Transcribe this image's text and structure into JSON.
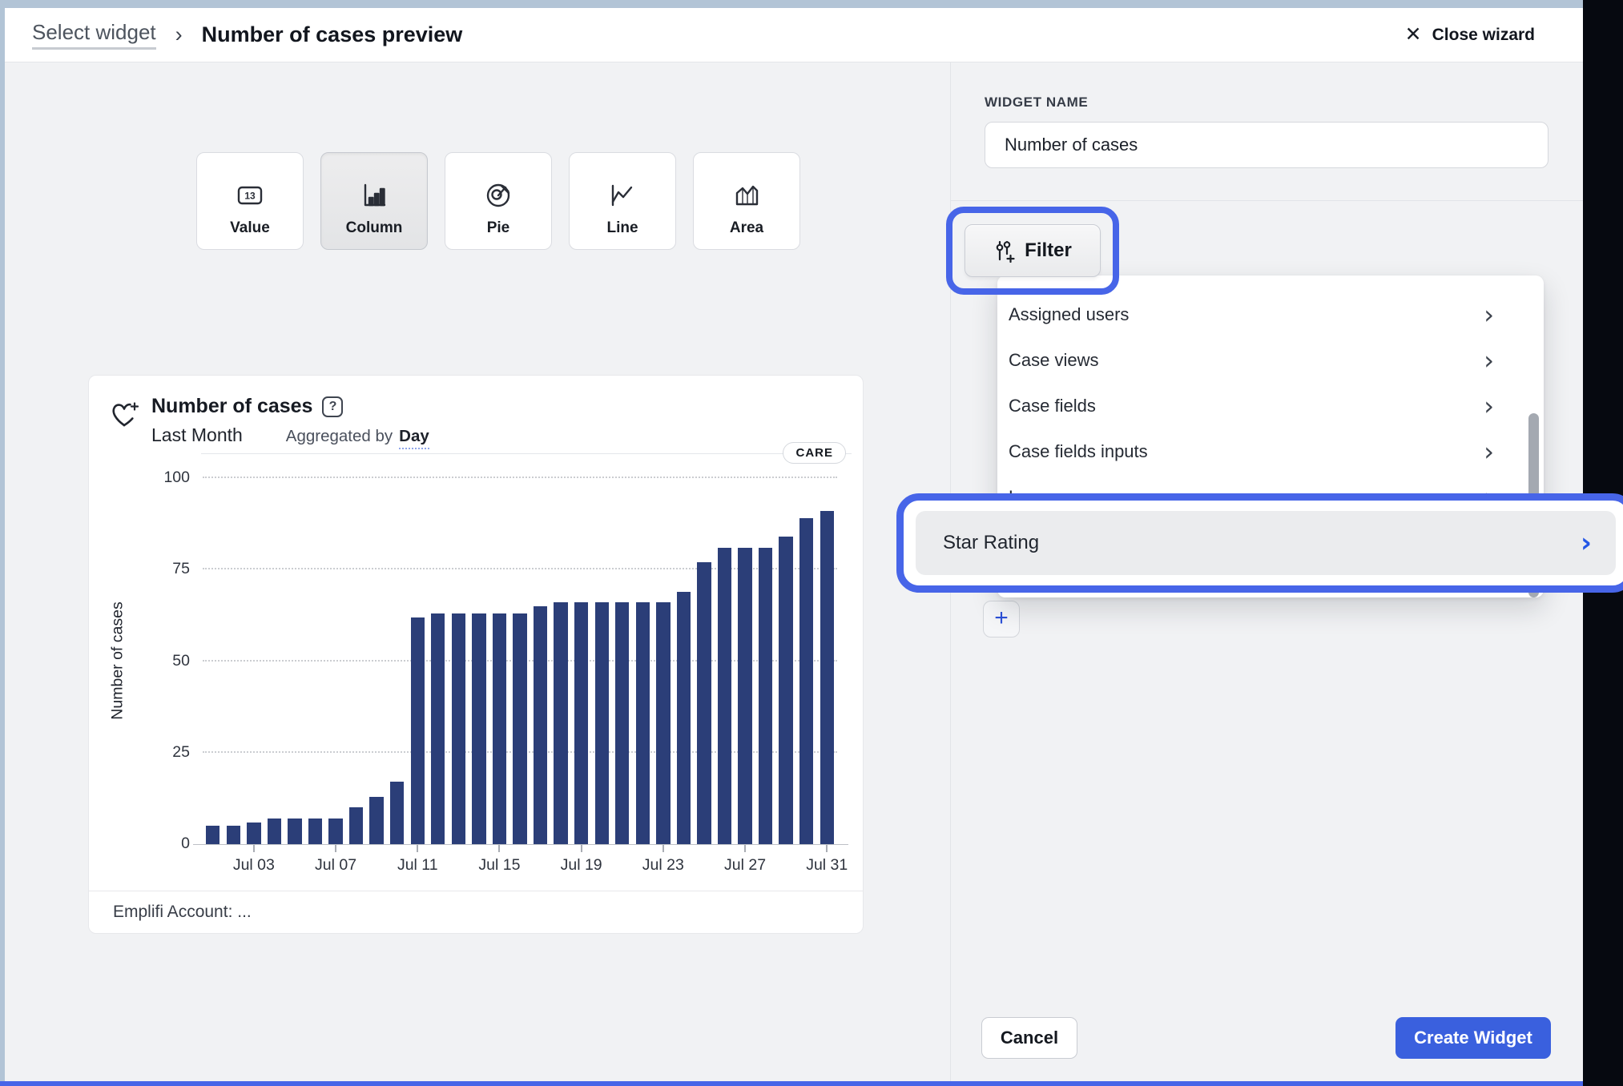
{
  "colors": {
    "accent_blue": "#4765e8",
    "primary_button": "#3a60de",
    "bar_navy": "#2b3e78"
  },
  "icons": {
    "close": "✕",
    "chevron_right": "›",
    "breadcrumb_sep": "›",
    "plus": "+",
    "help": "?"
  },
  "topbar": {
    "breadcrumb": "Select widget",
    "title": "Number of cases preview",
    "close_label": "Close wizard"
  },
  "chart_types": [
    {
      "label": "Value",
      "selected": false
    },
    {
      "label": "Column",
      "selected": true
    },
    {
      "label": "Pie",
      "selected": false
    },
    {
      "label": "Line",
      "selected": false
    },
    {
      "label": "Area",
      "selected": false
    }
  ],
  "widget_card": {
    "title": "Number of cases",
    "period": "Last Month",
    "aggregated_prefix": "Aggregated by",
    "aggregated_value": "Day",
    "badge": "CARE",
    "footer": "Emplifi Account: ..."
  },
  "chart_data": {
    "type": "bar",
    "title": "Number of cases",
    "period": "Last Month",
    "aggregation": "Day",
    "ylabel": "Number of cases",
    "ylim": [
      0,
      100
    ],
    "yticks": [
      0,
      25,
      50,
      75,
      100
    ],
    "grid": "dotted-horizontal",
    "bar_color": "#2b3e78",
    "x": [
      "Jul 01",
      "Jul 02",
      "Jul 03",
      "Jul 04",
      "Jul 05",
      "Jul 06",
      "Jul 07",
      "Jul 08",
      "Jul 09",
      "Jul 10",
      "Jul 11",
      "Jul 12",
      "Jul 13",
      "Jul 14",
      "Jul 15",
      "Jul 16",
      "Jul 17",
      "Jul 18",
      "Jul 19",
      "Jul 20",
      "Jul 21",
      "Jul 22",
      "Jul 23",
      "Jul 24",
      "Jul 25",
      "Jul 26",
      "Jul 27",
      "Jul 28",
      "Jul 29",
      "Jul 30",
      "Jul 31"
    ],
    "values": [
      5,
      5,
      6,
      7,
      7,
      7,
      7,
      10,
      13,
      17,
      62,
      63,
      63,
      63,
      63,
      63,
      65,
      66,
      66,
      66,
      66,
      66,
      66,
      69,
      77,
      81,
      81,
      81,
      84,
      89,
      91
    ],
    "x_tick_labels": [
      "Jul 03",
      "Jul 07",
      "Jul 11",
      "Jul 15",
      "Jul 19",
      "Jul 23",
      "Jul 27",
      "Jul 31"
    ],
    "x_tick_indices": [
      2,
      6,
      10,
      14,
      18,
      22,
      26,
      30
    ]
  },
  "panel": {
    "widget_name_label": "WIDGET NAME",
    "widget_name_value": "Number of cases",
    "filter_button": "Filter",
    "dropdown_items": [
      {
        "label": "Assigned users"
      },
      {
        "label": "Case views"
      },
      {
        "label": "Case fields"
      },
      {
        "label": "Case fields inputs"
      },
      {
        "label": "Languages",
        "partially_hidden": true
      }
    ],
    "highlighted_item": "Star Rating",
    "add_button": "+",
    "cancel": "Cancel",
    "create": "Create Widget"
  }
}
